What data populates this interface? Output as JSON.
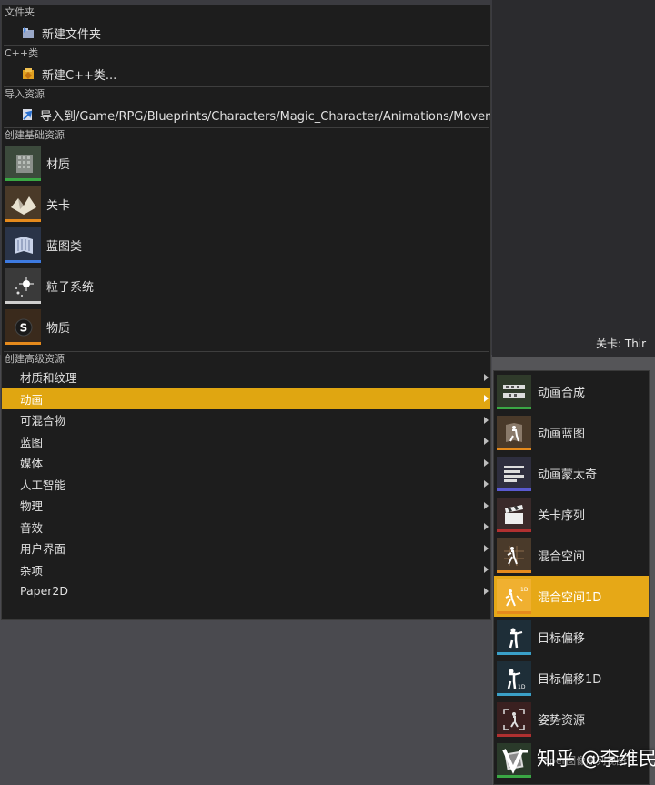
{
  "viewport": {
    "level_text": "关卡: Thir"
  },
  "menu": {
    "folder": {
      "header": "文件夹",
      "new_folder": "新建文件夹"
    },
    "cpp": {
      "header": "C++类",
      "new_cpp": "新建C++类..."
    },
    "import": {
      "header": "导入资源",
      "import_to": "导入到/Game/RPG/Blueprints/Characters/Magic_Character/Animations/Movement..."
    },
    "basic": {
      "header": "创建基础资源",
      "items": [
        {
          "label": "材质",
          "icon": "material-icon",
          "color": "#3aa844"
        },
        {
          "label": "关卡",
          "icon": "level-icon",
          "color": "#e58a1c"
        },
        {
          "label": "蓝图类",
          "icon": "blueprint-class-icon",
          "color": "#3d7ae0"
        },
        {
          "label": "粒子系统",
          "icon": "particle-system-icon",
          "color": "#cfcfcf"
        },
        {
          "label": "物质",
          "icon": "substance-icon",
          "color": "#e58a1c"
        }
      ]
    },
    "advanced": {
      "header": "创建高级资源",
      "items": [
        {
          "label": "材质和纹理"
        },
        {
          "label": "动画"
        },
        {
          "label": "可混合物"
        },
        {
          "label": "蓝图"
        },
        {
          "label": "媒体"
        },
        {
          "label": "人工智能"
        },
        {
          "label": "物理"
        },
        {
          "label": "音效"
        },
        {
          "label": "用户界面"
        },
        {
          "label": "杂项"
        },
        {
          "label": "Paper2D"
        }
      ],
      "active_index": 1
    }
  },
  "submenu": {
    "items": [
      {
        "label": "动画合成",
        "icon": "anim-composite-icon",
        "color": "#3aa844"
      },
      {
        "label": "动画蓝图",
        "icon": "anim-blueprint-icon",
        "color": "#e58a1c"
      },
      {
        "label": "动画蒙太奇",
        "icon": "anim-montage-icon",
        "color": "#5a5ad0"
      },
      {
        "label": "关卡序列",
        "icon": "level-sequence-icon",
        "color": "#b03030"
      },
      {
        "label": "混合空间",
        "icon": "blend-space-icon",
        "color": "#e58a1c"
      },
      {
        "label": "混合空间1D",
        "icon": "blend-space-1d-icon",
        "color": "#e58a1c"
      },
      {
        "label": "目标偏移",
        "icon": "aim-offset-icon",
        "color": "#3aa0c8"
      },
      {
        "label": "目标偏移1D",
        "icon": "aim-offset-1d-icon",
        "color": "#3aa0c8"
      },
      {
        "label": "姿势资源",
        "icon": "pose-asset-icon",
        "color": "#b03030"
      },
      {
        "label": "Paper图像序列视图",
        "icon": "paper-flipbook-icon",
        "color": "#3aa844"
      }
    ],
    "active_index": 5
  },
  "watermark": {
    "text": "知乎 @李维民"
  }
}
